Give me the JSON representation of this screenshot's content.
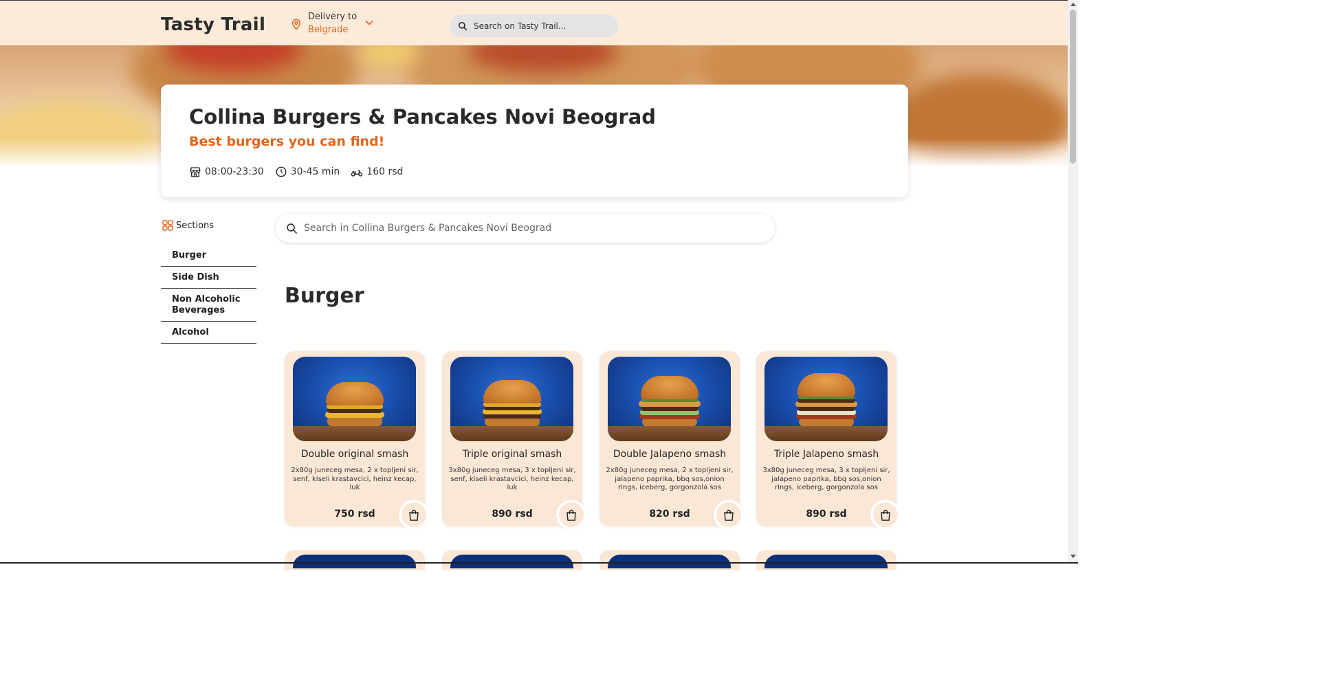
{
  "header": {
    "logo": "Tasty Trail",
    "delivery_label": "Delivery to",
    "delivery_city": "Belgrade",
    "search_placeholder": "Search on Tasty Trail..."
  },
  "restaurant": {
    "name": "Collina Burgers & Pancakes Novi Beograd",
    "tagline": "Best burgers you can find!",
    "hours": "08:00-23:30",
    "delivery_time": "30-45 min",
    "delivery_fee": "160 rsd"
  },
  "sidebar": {
    "title": "Sections",
    "items": [
      {
        "label": "Burger"
      },
      {
        "label": "Side Dish"
      },
      {
        "label": "Non Alcoholic Beverages"
      },
      {
        "label": "Alcohol"
      }
    ]
  },
  "menu_search": {
    "placeholder": "Search in Collina Burgers & Pancakes Novi Beograd"
  },
  "section": {
    "title": "Burger"
  },
  "products": [
    {
      "name": "Double original smash",
      "description": "2x80g juneceg mesa, 2 x topljeni sir, senf, kiseli krastavcici, heinz kecap, luk",
      "price": "750 rsd"
    },
    {
      "name": "Triple original smash",
      "description": "3x80g juneceg mesa, 3 x topljeni sir, senf, kiseli krastavcici, heinz kecap, luk",
      "price": "890 rsd"
    },
    {
      "name": "Double Jalapeno smash",
      "description": "2x80g juneceg mesa, 2 x topljeni sir, jalapeno paprika, bbq sos,onion rings, iceberg, gorgonzola sos",
      "price": "820 rsd"
    },
    {
      "name": "Triple Jalapeno smash",
      "description": "3x80g juneceg mesa, 3 x topljeni sir, jalapeno paprika, bbq sos,onion rings, iceberg, gorgonzola sos",
      "price": "890 rsd"
    }
  ],
  "colors": {
    "accent": "#e0661f",
    "header_bg": "#fdebd9",
    "card_bg": "#fbe7d5"
  },
  "icons": {
    "location": "map-pin-icon",
    "chevron": "chevron-down-icon",
    "search": "search-icon",
    "store": "store-icon",
    "clock": "clock-icon",
    "delivery": "scooter-icon",
    "sections": "grid-icon",
    "cart": "shopping-bag-icon"
  }
}
